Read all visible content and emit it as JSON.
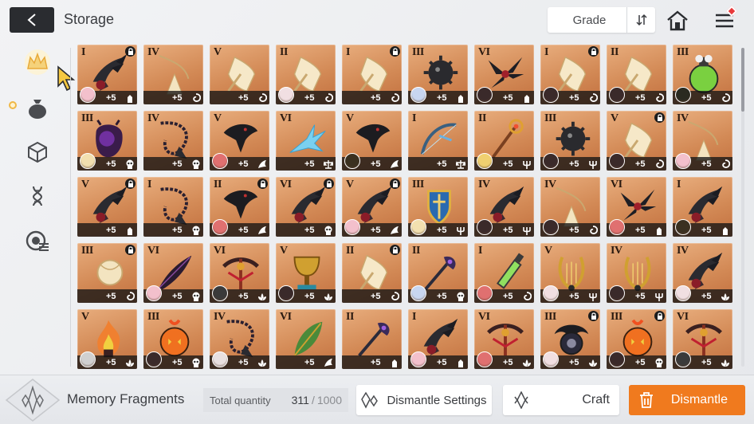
{
  "header": {
    "title": "Storage",
    "grade_label": "Grade"
  },
  "colors": {
    "accent": "#f07a1e",
    "card_bg": "#d38a56",
    "lock_bg": "#1c1c1c",
    "selected_tab": "#f0b846"
  },
  "sidebar": {
    "tabs": [
      {
        "icon": "crown-icon",
        "selected": true
      },
      {
        "icon": "bag-icon",
        "selected": false
      },
      {
        "icon": "cube-icon",
        "selected": false
      },
      {
        "icon": "dna-icon",
        "selected": false
      },
      {
        "icon": "module-icon",
        "selected": false
      }
    ]
  },
  "items": [
    {
      "grade": "I",
      "level": "+5",
      "locked": true,
      "kind": "claw",
      "avatar": "#f3c0cc",
      "type": "tower-icon"
    },
    {
      "grade": "IV",
      "level": "+5",
      "locked": false,
      "kind": "pendant",
      "avatar": "",
      "type": "swirl-icon"
    },
    {
      "grade": "V",
      "level": "+5",
      "locked": false,
      "kind": "lantern",
      "avatar": "",
      "type": "swirl-icon"
    },
    {
      "grade": "II",
      "level": "+5",
      "locked": false,
      "kind": "lantern",
      "avatar": "#f1dfe2",
      "type": "swirl-icon"
    },
    {
      "grade": "I",
      "level": "+5",
      "locked": true,
      "kind": "lantern",
      "avatar": "",
      "type": "swirl-icon"
    },
    {
      "grade": "III",
      "level": "+5",
      "locked": false,
      "kind": "mace",
      "avatar": "#c8d6f0",
      "type": "tower-icon"
    },
    {
      "grade": "VI",
      "level": "+5",
      "locked": false,
      "kind": "talon",
      "avatar": "#3a2a2a",
      "type": "tower-icon"
    },
    {
      "grade": "I",
      "level": "+5",
      "locked": true,
      "kind": "lantern",
      "avatar": "#3a2a2a",
      "type": "swirl-icon"
    },
    {
      "grade": "II",
      "level": "+5",
      "locked": false,
      "kind": "lantern",
      "avatar": "#3a2a2a",
      "type": "swirl-icon"
    },
    {
      "grade": "III",
      "level": "+5",
      "locked": false,
      "kind": "potion",
      "avatar": "#2a2a20",
      "type": "swirl-icon"
    },
    {
      "grade": "III",
      "level": "+5",
      "locked": false,
      "kind": "orb",
      "avatar": "#f2e0b0",
      "type": "skull-icon"
    },
    {
      "grade": "IV",
      "level": "+5",
      "locked": false,
      "kind": "chain",
      "avatar": "",
      "type": "skull-icon"
    },
    {
      "grade": "V",
      "level": "+5",
      "locked": false,
      "kind": "crow",
      "avatar": "#e07070",
      "type": "wing-icon"
    },
    {
      "grade": "VI",
      "level": "+5",
      "locked": false,
      "kind": "crystal",
      "avatar": "",
      "type": "scale-icon"
    },
    {
      "grade": "V",
      "level": "+5",
      "locked": false,
      "kind": "crow",
      "avatar": "#3a3020",
      "type": "wing-icon"
    },
    {
      "grade": "I",
      "level": "+5",
      "locked": false,
      "kind": "bow",
      "avatar": "",
      "type": "scale-icon"
    },
    {
      "grade": "II",
      "level": "+5",
      "locked": false,
      "kind": "staff",
      "avatar": "#f0d070",
      "type": "trident-icon"
    },
    {
      "grade": "III",
      "level": "+5",
      "locked": false,
      "kind": "mace",
      "avatar": "#3a2a2a",
      "type": "trident-icon"
    },
    {
      "grade": "V",
      "level": "+5",
      "locked": true,
      "kind": "lantern",
      "avatar": "#3a2a2a",
      "type": "swirl-icon"
    },
    {
      "grade": "IV",
      "level": "+5",
      "locked": false,
      "kind": "pendant",
      "avatar": "#f3c0cc",
      "type": "swirl-icon"
    },
    {
      "grade": "V",
      "level": "+5",
      "locked": true,
      "kind": "claw",
      "avatar": "",
      "type": "tower-icon"
    },
    {
      "grade": "I",
      "level": "+5",
      "locked": false,
      "kind": "chain",
      "avatar": "",
      "type": "skull-icon"
    },
    {
      "grade": "II",
      "level": "+5",
      "locked": true,
      "kind": "crow",
      "avatar": "#e07070",
      "type": "wing-icon"
    },
    {
      "grade": "VI",
      "level": "+5",
      "locked": true,
      "kind": "claw",
      "avatar": "",
      "type": "skull-icon"
    },
    {
      "grade": "V",
      "level": "+5",
      "locked": true,
      "kind": "claw",
      "avatar": "#f3c0cc",
      "type": "wing-icon"
    },
    {
      "grade": "III",
      "level": "+5",
      "locked": false,
      "kind": "shield",
      "avatar": "#f2e0b0",
      "type": "trident-icon"
    },
    {
      "grade": "IV",
      "level": "+5",
      "locked": false,
      "kind": "claw",
      "avatar": "#3a2a2a",
      "type": "trident-icon"
    },
    {
      "grade": "IV",
      "level": "+5",
      "locked": false,
      "kind": "pendant",
      "avatar": "#3a2a2a",
      "type": "swirl-icon"
    },
    {
      "grade": "VI",
      "level": "+5",
      "locked": false,
      "kind": "talon",
      "avatar": "#e07070",
      "type": "tower-icon"
    },
    {
      "grade": "I",
      "level": "+5",
      "locked": false,
      "kind": "claw",
      "avatar": "#3a3020",
      "type": "tower-icon"
    },
    {
      "grade": "III",
      "level": "+5",
      "locked": true,
      "kind": "orb-pale",
      "avatar": "",
      "type": "swirl-icon"
    },
    {
      "grade": "VI",
      "level": "+5",
      "locked": false,
      "kind": "feather",
      "avatar": "#f3c0cc",
      "type": "skull-icon"
    },
    {
      "grade": "VI",
      "level": "+5",
      "locked": false,
      "kind": "crossbow",
      "avatar": "#3a3a3a",
      "type": "lotus-icon"
    },
    {
      "grade": "V",
      "level": "+5",
      "locked": false,
      "kind": "chalice",
      "avatar": "#3a2a2a",
      "type": "lotus-icon"
    },
    {
      "grade": "II",
      "level": "+5",
      "locked": true,
      "kind": "lantern",
      "avatar": "",
      "type": "swirl-icon"
    },
    {
      "grade": "II",
      "level": "+5",
      "locked": false,
      "kind": "axe",
      "avatar": "#c8d6f0",
      "type": "skull-icon"
    },
    {
      "grade": "I",
      "level": "+5",
      "locked": false,
      "kind": "vial",
      "avatar": "#e07070",
      "type": "swirl-icon"
    },
    {
      "grade": "V",
      "level": "+5",
      "locked": false,
      "kind": "lyre",
      "avatar": "#f1dfe2",
      "type": "trident-icon"
    },
    {
      "grade": "IV",
      "level": "+5",
      "locked": false,
      "kind": "lyre",
      "avatar": "#3a2a2a",
      "type": "trident-icon"
    },
    {
      "grade": "IV",
      "level": "+5",
      "locked": false,
      "kind": "claw",
      "avatar": "#f1dfe2",
      "type": "lotus-icon"
    },
    {
      "grade": "V",
      "level": "+5",
      "locked": false,
      "kind": "flame",
      "avatar": "#d0d0d0",
      "type": "lotus-icon"
    },
    {
      "grade": "III",
      "level": "+5",
      "locked": false,
      "kind": "pumpkin",
      "avatar": "#3a2a2a",
      "type": "skull-icon"
    },
    {
      "grade": "IV",
      "level": "+5",
      "locked": false,
      "kind": "chain",
      "avatar": "#e8e0e0",
      "type": "lotus-icon"
    },
    {
      "grade": "VI",
      "level": "+5",
      "locked": false,
      "kind": "leaf",
      "avatar": "",
      "type": "wing-icon"
    },
    {
      "grade": "II",
      "level": "+5",
      "locked": false,
      "kind": "axe",
      "avatar": "",
      "type": "tower-icon"
    },
    {
      "grade": "I",
      "level": "+5",
      "locked": false,
      "kind": "claw",
      "avatar": "#f3c0cc",
      "type": "tower-icon"
    },
    {
      "grade": "VI",
      "level": "+5",
      "locked": false,
      "kind": "crossbow",
      "avatar": "#e07070",
      "type": "lotus-icon"
    },
    {
      "grade": "III",
      "level": "+5",
      "locked": true,
      "kind": "orb-dark",
      "avatar": "#f1dfe2",
      "type": "lotus-icon"
    },
    {
      "grade": "III",
      "level": "+5",
      "locked": true,
      "kind": "pumpkin",
      "avatar": "#3a2a2a",
      "type": "skull-icon"
    },
    {
      "grade": "VI",
      "level": "+5",
      "locked": false,
      "kind": "crossbow",
      "avatar": "#3a3a3a",
      "type": "lotus-icon"
    }
  ],
  "footer": {
    "fragments_label": "Memory Fragments",
    "total_quantity_label": "Total quantity",
    "quantity_current": "311",
    "quantity_separator": "/",
    "quantity_max": "1000",
    "settings_label": "Dismantle Settings",
    "craft_label": "Craft",
    "dismantle_label": "Dismantle"
  }
}
